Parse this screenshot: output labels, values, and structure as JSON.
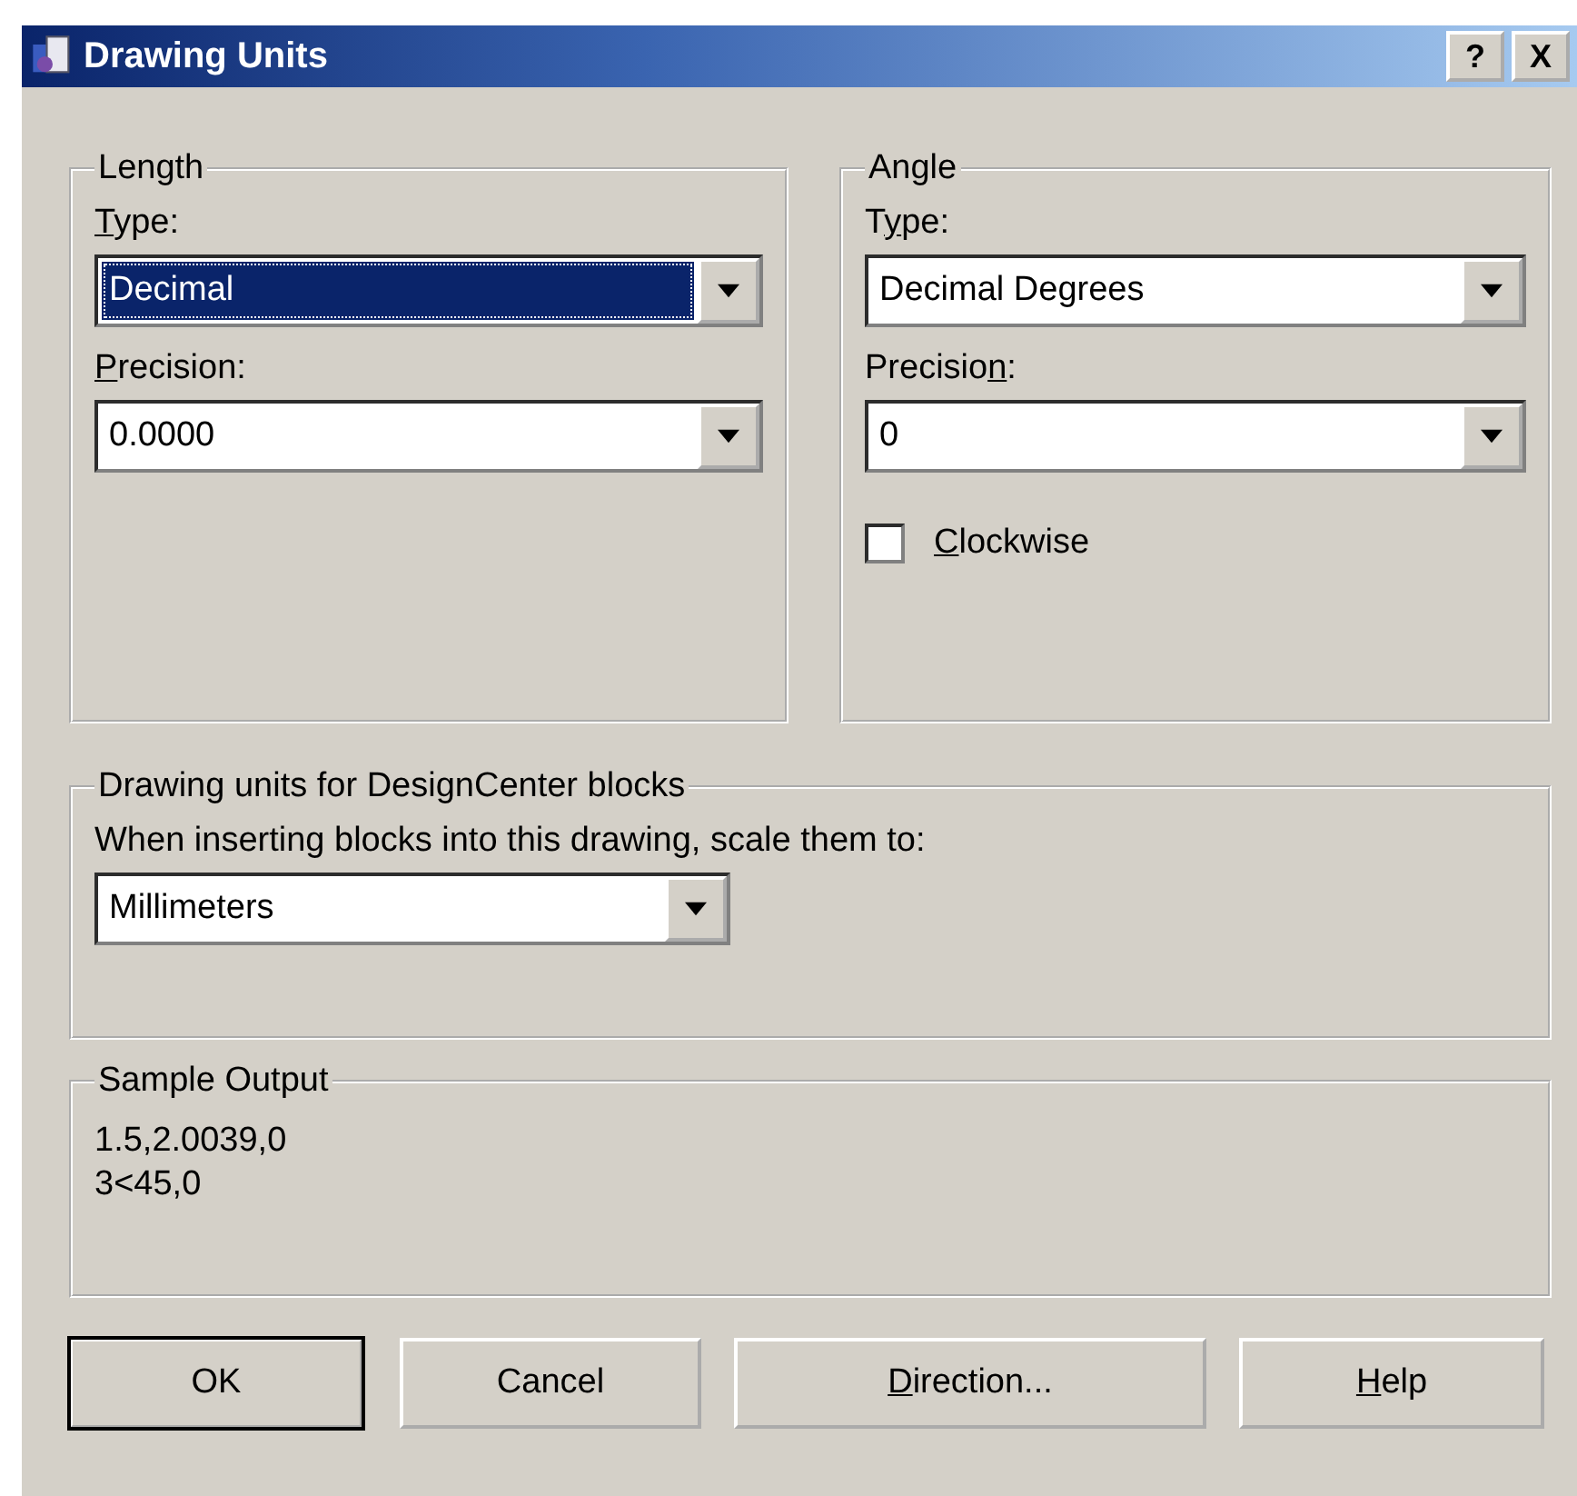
{
  "window": {
    "title": "Drawing Units",
    "help_button": "?",
    "close_button": "X"
  },
  "length": {
    "title": "Length",
    "fields": [
      {
        "label": {
          "key": "T",
          "post": "ype:"
        },
        "value": "Decimal",
        "focused": true
      },
      {
        "label": {
          "key": "P",
          "post": "recision:"
        },
        "value": "0.0000",
        "focused": false
      }
    ]
  },
  "angle": {
    "title": "Angle",
    "fields": [
      {
        "label": {
          "pre": "T",
          "key": "y",
          "post": "pe:"
        },
        "value": "Decimal Degrees",
        "focused": false
      },
      {
        "label": {
          "pre": "Precisio",
          "key": "n",
          "post": ":"
        },
        "value": "0",
        "focused": false
      }
    ],
    "clockwise": {
      "label": {
        "key": "C",
        "post": "lockwise"
      },
      "checked": false
    }
  },
  "designcenter": {
    "title": "Drawing units for DesignCenter blocks",
    "prompt": "When inserting blocks into this drawing, scale them to:",
    "value": "Millimeters",
    "focused": false
  },
  "sample_output": {
    "title": "Sample Output",
    "lines": [
      "1.5,2.0039,0",
      "3<45,0"
    ]
  },
  "buttons": [
    {
      "label": {
        "post": "OK"
      },
      "default": true
    },
    {
      "label": {
        "post": "Cancel"
      },
      "default": false
    },
    {
      "label": {
        "key": "D",
        "post": "irection..."
      },
      "default": false
    },
    {
      "label": {
        "key": "H",
        "post": "elp"
      },
      "default": false
    }
  ]
}
